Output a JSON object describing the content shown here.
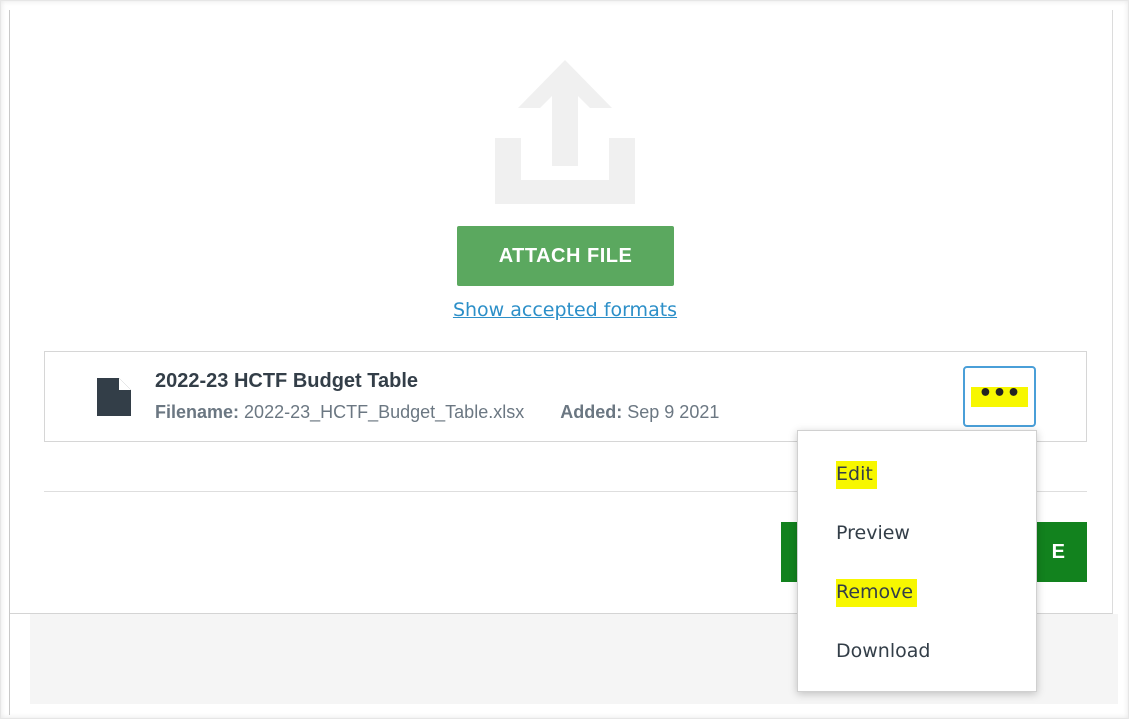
{
  "upload": {
    "attach_label": "ATTACH FILE",
    "formats_link": "Show accepted formats"
  },
  "file": {
    "title": "2022-23 HCTF Budget Table",
    "filename_label": "Filename:",
    "filename_value": "2022-23_HCTF_Budget_Table.xlsx",
    "added_label": "Added:",
    "added_value": "Sep 9 2021",
    "more_label": "•••"
  },
  "actions": {
    "save_visible_text": "E"
  },
  "menu": {
    "items": [
      {
        "label": "Edit",
        "highlighted": true
      },
      {
        "label": "Preview",
        "highlighted": false
      },
      {
        "label": "Remove",
        "highlighted": true
      },
      {
        "label": "Download",
        "highlighted": false
      }
    ]
  },
  "colors": {
    "attach_button": "#5ba85f",
    "primary_button": "#12821e",
    "link": "#2c8fc8",
    "highlight": "#f7f700",
    "focus_border": "#4a9fd8",
    "text_dark": "#333e48"
  },
  "icons": {
    "upload": "upload-arrow-icon",
    "file": "document-icon",
    "more": "more-options-icon"
  }
}
